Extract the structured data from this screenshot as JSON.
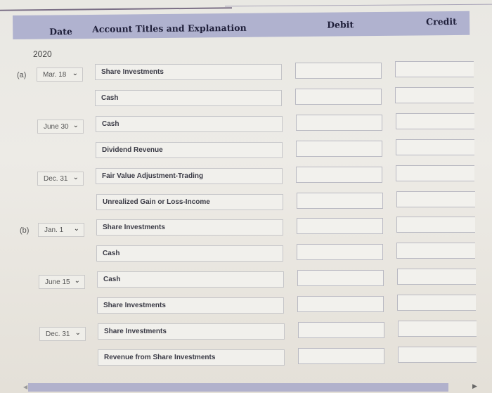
{
  "header": {
    "date": "Date",
    "account": "Account Titles and Explanation",
    "debit": "Debit",
    "credit": "Credit"
  },
  "year": "2020",
  "parts": {
    "a": "(a)",
    "b": "(b)"
  },
  "chevron": "⌄",
  "rows": [
    {
      "date": "Mar. 18",
      "account": "Share Investments",
      "debit": "",
      "credit": ""
    },
    {
      "date": "",
      "account": "Cash",
      "debit": "",
      "credit": ""
    },
    {
      "date": "June 30",
      "account": "Cash",
      "debit": "",
      "credit": ""
    },
    {
      "date": "",
      "account": "Dividend Revenue",
      "debit": "",
      "credit": ""
    },
    {
      "date": "Dec. 31",
      "account": "Fair Value Adjustment-Trading",
      "debit": "",
      "credit": ""
    },
    {
      "date": "",
      "account": "Unrealized Gain or Loss-Income",
      "debit": "",
      "credit": ""
    },
    {
      "date": "Jan. 1",
      "account": "Share Investments",
      "debit": "",
      "credit": ""
    },
    {
      "date": "",
      "account": "Cash",
      "debit": "",
      "credit": ""
    },
    {
      "date": "June 15",
      "account": "Cash",
      "debit": "",
      "credit": ""
    },
    {
      "date": "",
      "account": "Share Investments",
      "debit": "",
      "credit": ""
    },
    {
      "date": "Dec. 31",
      "account": "Share Investments",
      "debit": "",
      "credit": ""
    },
    {
      "date": "",
      "account": "Revenue from Share Investments",
      "debit": "",
      "credit": ""
    }
  ],
  "scroll": {
    "left": "◀",
    "right": "▶"
  }
}
